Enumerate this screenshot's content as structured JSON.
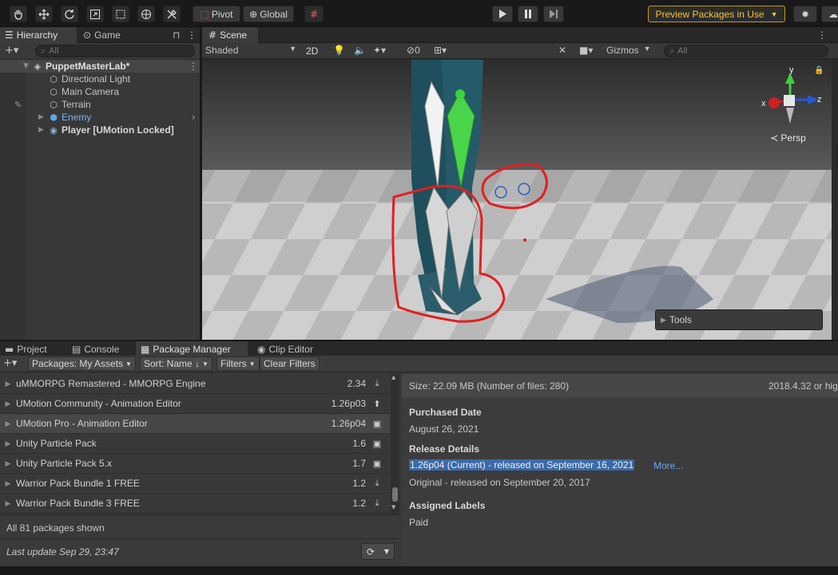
{
  "toolbar": {
    "pivot_label": "Pivot",
    "global_label": "Global",
    "preview_label": "Preview Packages in Use",
    "preview_caret": "▼",
    "tools": [
      "hand-tool-icon",
      "move-tool-icon",
      "rotate-tool-icon",
      "scale-tool-icon",
      "rect-tool-icon",
      "transform-tool-icon",
      "custom-tool-icon"
    ]
  },
  "hierarchy": {
    "tab_hierarchy": "Hierarchy",
    "tab_game": "Game",
    "search_placeholder": "All",
    "scene_name": "PuppetMasterLab*",
    "items": [
      {
        "label": "Directional Light"
      },
      {
        "label": "Main Camera"
      },
      {
        "label": "Terrain"
      },
      {
        "label": "Enemy"
      },
      {
        "label": "Player [UMotion Locked]"
      }
    ]
  },
  "scene": {
    "tab": "Scene",
    "shading": "Shaded",
    "mode_2d": "2D",
    "hidden_count": "0",
    "gizmos": "Gizmos",
    "search_placeholder": "All",
    "persp": "Persp",
    "tools_label": "Tools",
    "axis_x": "x",
    "axis_y": "y",
    "axis_z": "z"
  },
  "bottom": {
    "tabs": [
      "Project",
      "Console",
      "Package Manager",
      "Clip Editor"
    ],
    "packages_dropdown": "Packages: My Assets",
    "sort_dropdown": "Sort: Name ↓",
    "filters_dropdown": "Filters",
    "clear_filters": "Clear Filters",
    "packages": [
      {
        "name": "uMMORPG Remastered - MMORPG Engine",
        "version": "2.34",
        "status": "download"
      },
      {
        "name": "UMotion Community - Animation Editor",
        "version": "1.26p03",
        "status": "update"
      },
      {
        "name": "UMotion Pro - Animation Editor",
        "version": "1.26p04",
        "status": "imported"
      },
      {
        "name": "Unity Particle Pack",
        "version": "1.6",
        "status": "imported"
      },
      {
        "name": "Unity Particle Pack 5.x",
        "version": "1.7",
        "status": "imported"
      },
      {
        "name": "Warrior Pack Bundle 1 FREE",
        "version": "1.2",
        "status": "download"
      },
      {
        "name": "Warrior Pack Bundle 3 FREE",
        "version": "1.2",
        "status": "download"
      }
    ],
    "packages_shown": "All 81 packages shown",
    "last_update": "Last update Sep 29, 23:47"
  },
  "details": {
    "size": "Size: 22.09 MB (Number of files: 280)",
    "unity_version": "2018.4.32 or hig",
    "purchased_heading": "Purchased Date",
    "purchased_date": "August 26, 2021",
    "release_heading": "Release Details",
    "release_current": "1.26p04 (Current) - released on September 16, 2021",
    "more_link": "More...",
    "release_original": "Original - released on September 20, 2017",
    "labels_heading": "Assigned Labels",
    "label_paid": "Paid"
  },
  "colors": {
    "selection": "#3a6aa8",
    "preview_border": "#c69b0b",
    "annotation_red": "#e02020",
    "bone_green": "#3ed13e"
  }
}
